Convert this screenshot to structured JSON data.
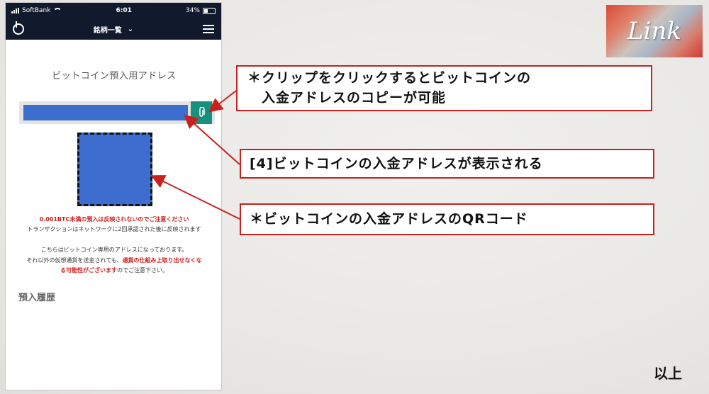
{
  "status_bar": {
    "carrier": "SoftBank",
    "time": "6:01",
    "battery": "34%"
  },
  "nav": {
    "title": "銘柄一覧",
    "chevron_icon": "chevron-down-icon",
    "menu_icon": "hamburger-icon",
    "logo_icon": "b-logo-icon"
  },
  "page": {
    "heading": "ビットコイン預入用アドレス",
    "copy_icon": "paperclip-icon",
    "notes": {
      "min_warning": "0.001BTC未満の預入は反映されないのでご注意ください",
      "confirmation": "トランザクションはネットワークに2回承認された後に反映されます",
      "dedicated_1": "こちらはビットコイン専用のアドレスになっております。",
      "dedicated_2a": "それ以外の仮想通貨を送金されても、",
      "dedicated_2b": "通貨の仕組み上取り出せなくな",
      "dedicated_3a": "る可能性がございます",
      "dedicated_3b": "のでご注意下さい。"
    },
    "history_title": "預入履歴"
  },
  "callouts": {
    "clip_line1": "＊クリップをクリックするとビットコインの",
    "clip_line2": "　入金アドレスのコピーが可能",
    "address_shown": "[4]ビットコインの入金アドレスが表示される",
    "qr_code": "＊ビットコインの入金アドレスのQRコード"
  },
  "brand": {
    "logo_text": "Link"
  },
  "footer": {
    "end_label": "以上"
  },
  "colors": {
    "accent_red": "#c9211e",
    "nav_bg": "#111a2c",
    "teal": "#16907f",
    "blue": "#3c6ecf"
  }
}
